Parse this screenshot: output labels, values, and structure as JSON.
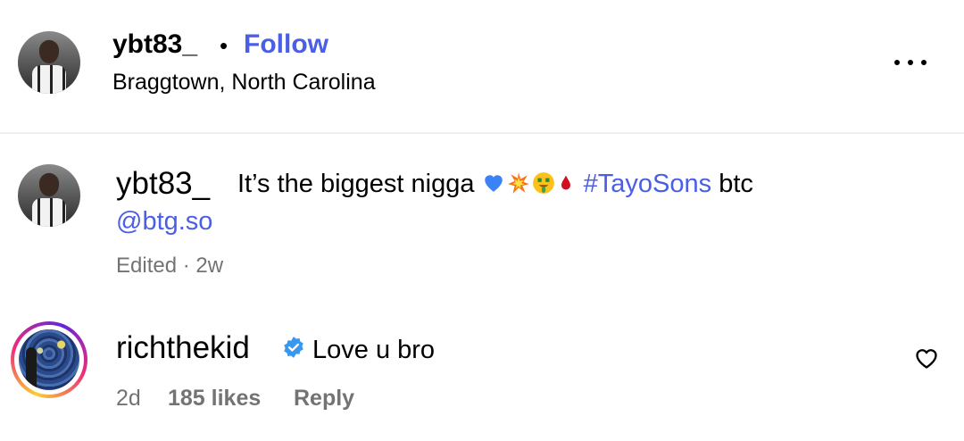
{
  "post_header": {
    "username": "ybt83_",
    "separator": "•",
    "follow_label": "Follow",
    "location": "Braggtown, North Carolina",
    "more_icon": "more-horizontal-icon"
  },
  "caption": {
    "username": "ybt83_",
    "text_before": "It’s the biggest nigga",
    "emojis": [
      "blue-heart-emoji",
      "collision-emoji",
      "money-mouth-face-emoji",
      "drop-of-blood-emoji"
    ],
    "hashtag": "#TayoSons",
    "text_after": "btc",
    "mention": "@btg.so",
    "edited_label": "Edited",
    "meta_separator": "·",
    "time": "2w"
  },
  "comment": {
    "username": "richthekid",
    "verified_icon": "verified-badge-icon",
    "text": "Love u bro",
    "time": "2d",
    "likes": "185 likes",
    "reply_label": "Reply",
    "like_icon": "heart-outline-icon"
  },
  "colors": {
    "link": "#4a5ee6",
    "muted": "#737373",
    "verified": "#3897f0",
    "divider": "#efefef"
  }
}
